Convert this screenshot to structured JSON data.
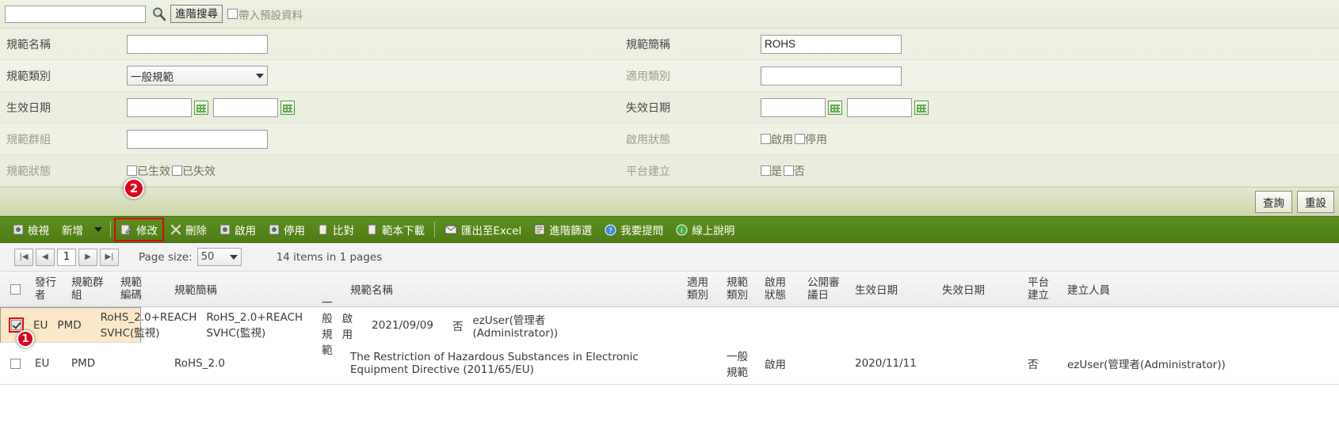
{
  "quick_search": {
    "input_value": "",
    "input_placeholder": "",
    "search_icon": "magnifier-icon",
    "advanced_button": "進階搜尋",
    "default_data_checkbox": {
      "label": "帶入預設資料",
      "checked": false
    }
  },
  "form": {
    "rows": [
      {
        "left": {
          "label": "規範名稱",
          "dim": false,
          "type": "text",
          "value": ""
        },
        "right": {
          "label": "規範簡稱",
          "dim": false,
          "type": "text",
          "value": "ROHS"
        }
      },
      {
        "left": {
          "label": "規範類別",
          "dim": false,
          "type": "select",
          "value": "一般規範"
        },
        "right": {
          "label": "適用類別",
          "dim": true,
          "type": "text",
          "value": ""
        }
      },
      {
        "left": {
          "label": "生效日期",
          "dim": false,
          "type": "daterange",
          "value_from": "",
          "value_to": ""
        },
        "right": {
          "label": "失效日期",
          "dim": false,
          "type": "daterange",
          "value_from": "",
          "value_to": ""
        }
      },
      {
        "left": {
          "label": "規範群組",
          "dim": true,
          "type": "text",
          "value": ""
        },
        "right": {
          "label": "啟用狀態",
          "dim": true,
          "type": "checks",
          "options": [
            "啟用",
            "停用"
          ]
        }
      },
      {
        "left": {
          "label": "規範狀態",
          "dim": true,
          "type": "checks",
          "options": [
            "已生效",
            "已失效"
          ]
        },
        "right": {
          "label": "平台建立",
          "dim": true,
          "type": "checks",
          "options": [
            "是",
            "否"
          ]
        }
      }
    ],
    "buttons": {
      "query": "查詢",
      "reset": "重設"
    }
  },
  "badges": [
    {
      "number": "1",
      "target": "row-checkbox"
    },
    {
      "number": "2",
      "target": "modify-button"
    }
  ],
  "toolbar": {
    "items": [
      {
        "label": "檢視",
        "icon": "view-icon",
        "highlighted": false
      },
      {
        "label": "新增",
        "icon": "",
        "highlighted": false
      },
      {
        "label": "修改",
        "icon": "edit-icon",
        "highlighted": true
      },
      {
        "label": "刪除",
        "icon": "delete-icon",
        "highlighted": false
      },
      {
        "label": "啟用",
        "icon": "enable-icon",
        "highlighted": false
      },
      {
        "label": "停用",
        "icon": "disable-icon",
        "highlighted": false
      },
      {
        "label": "比對",
        "icon": "compare-icon",
        "highlighted": false
      },
      {
        "label": "範本下載",
        "icon": "template-download-icon",
        "highlighted": false
      },
      {
        "label": "匯出至Excel",
        "icon": "excel-export-icon",
        "highlighted": false
      },
      {
        "label": "進階篩選",
        "icon": "filter-icon",
        "highlighted": false
      },
      {
        "label": "我要提問",
        "icon": "question-icon",
        "highlighted": false
      },
      {
        "label": "線上說明",
        "icon": "help-info-icon",
        "highlighted": false
      }
    ]
  },
  "pager": {
    "first": "|◀",
    "prev": "◀",
    "current_page": "1",
    "next": "▶",
    "last": "▶|",
    "page_size_label": "Page size:",
    "page_size_value": "50",
    "items_text": "14 items in 1 pages"
  },
  "grid": {
    "select_all_checked": false,
    "columns": [
      {
        "key": "check",
        "label": ""
      },
      {
        "key": "pub",
        "label": "發行\n者"
      },
      {
        "key": "grp",
        "label": "規範群\n組"
      },
      {
        "key": "code",
        "label": "規範\n編碼"
      },
      {
        "key": "abbr",
        "label": "規範簡稱"
      },
      {
        "key": "name",
        "label": "規範名稱"
      },
      {
        "key": "apply",
        "label": "適用\n類別"
      },
      {
        "key": "type",
        "label": "規範\n類別"
      },
      {
        "key": "state",
        "label": "啟用\n狀態"
      },
      {
        "key": "open",
        "label": "公開審\n議日"
      },
      {
        "key": "eff",
        "label": "生效日期"
      },
      {
        "key": "exp",
        "label": "失效日期"
      },
      {
        "key": "plat",
        "label": "平台\n建立"
      },
      {
        "key": "user",
        "label": "建立人員"
      }
    ],
    "rows": [
      {
        "checked": true,
        "selected": true,
        "pub": "EU",
        "grp": "PMD",
        "code": "",
        "abbr": "RoHS_2.0+REACH SVHC(監視)",
        "name": "RoHS_2.0+REACH SVHC(監視)",
        "apply": "",
        "type": "一般\n規範",
        "state": "啟用",
        "open": "",
        "eff": "2021/09/09",
        "exp": "",
        "plat": "否",
        "user": "ezUser(管理者(Administrator))"
      },
      {
        "checked": false,
        "selected": false,
        "pub": "EU",
        "grp": "PMD",
        "code": "",
        "abbr": "RoHS_2.0",
        "name": "The Restriction of Hazardous Substances in Electronic Equipment Directive (2011/65/EU)",
        "apply": "",
        "type": "一般\n規範",
        "state": "啟用",
        "open": "",
        "eff": "2020/11/11",
        "exp": "",
        "plat": "否",
        "user": "ezUser(管理者(Administrator))"
      }
    ]
  },
  "colors": {
    "toolbar_green": "#4e7d16",
    "panel_bg": "#e9ecdb",
    "selected_row": "#fbe8c8",
    "badge_red": "#e1001a"
  }
}
